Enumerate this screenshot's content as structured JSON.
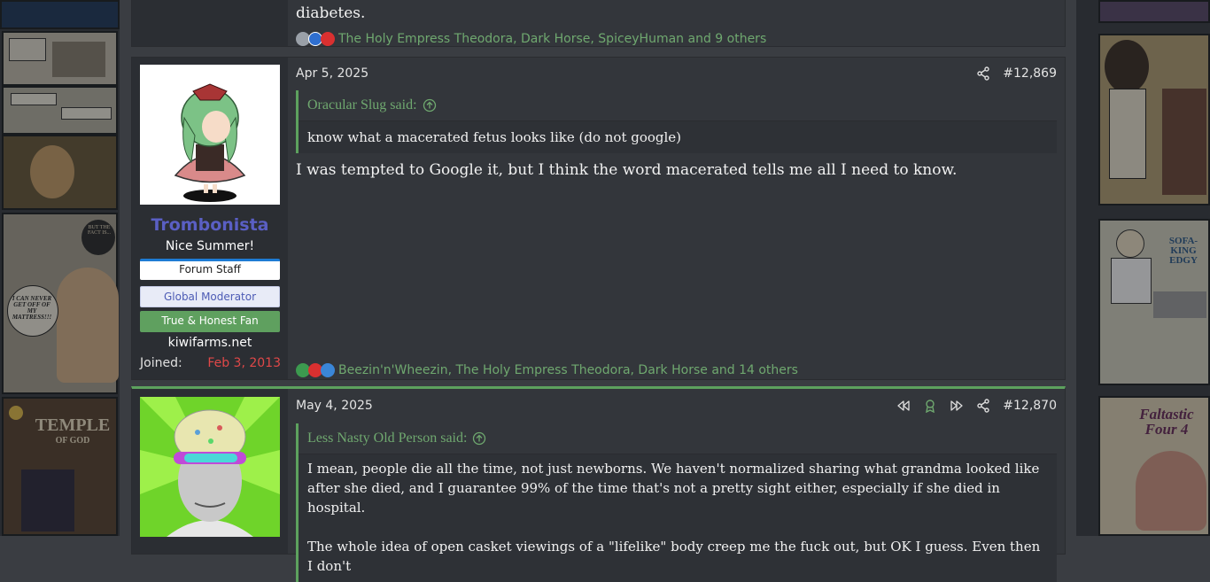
{
  "post_prev": {
    "body_tail": "diabetes.",
    "reactions_text": "The Holy Empress Theodora, Dark Horse, SpiceyHuman and 9 others"
  },
  "post_12869": {
    "user": {
      "name": "Trombonista",
      "title": "Nice Summer!",
      "banners": [
        "Forum Staff",
        "Global Moderator",
        "True & Honest Fan"
      ],
      "site": "kiwifarms.net",
      "joined_label": "Joined:",
      "joined_value": "Feb 3, 2013"
    },
    "date": "Apr 5, 2025",
    "number": "#12,869",
    "quote": {
      "author": "Oracular Slug said:",
      "text": "know what a macerated fetus looks like (do not google)"
    },
    "body": "I was tempted to Google it, but I think the word macerated tells me all I need to know.",
    "reactions_text": "Beezin'n'Wheezin, The Holy Empress Theodora, Dark Horse and 14 others"
  },
  "post_12870": {
    "date": "May 4, 2025",
    "number": "#12,870",
    "quote": {
      "author": "Less Nasty Old Person said:",
      "paragraph1": "I mean, people die all the time, not just newborns. We haven't normalized sharing what grandma looked like after she died, and I guarantee 99% of the time that's not a pretty sight either, especially if she died in hospital.",
      "paragraph2": "The whole idea of open casket viewings of a \"lifelike\" body creep me the fuck out, but OK I guess. Even then I don't"
    }
  },
  "side_art": {
    "left_title": "TEMPLE",
    "left_subtitle": "OF GOD",
    "left_bubble": "I CAN NEVER GET OFF OF MY MATTRESS!!!",
    "left_bubble_small": "BUT THE FACT IS...",
    "right_title": "Faltastic Four 4",
    "right_badge": "SOFA-KING EDGY"
  },
  "colors": {
    "accent_green": "#5da15e",
    "username_purple": "#5a5fc4",
    "joined_red": "#e04848",
    "staff_blue": "#1e7bd4"
  }
}
